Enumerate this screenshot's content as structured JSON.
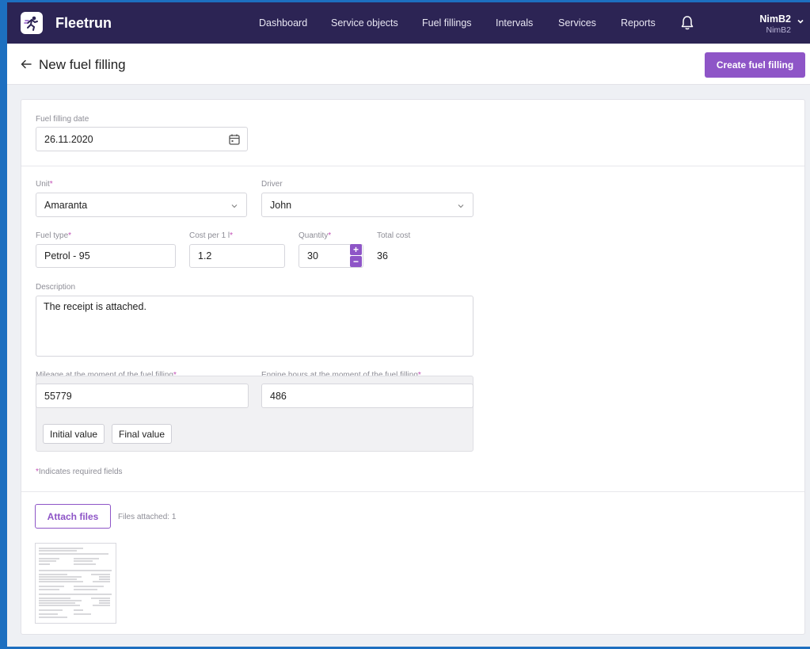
{
  "nav": {
    "app_name": "Fleetrun",
    "items": [
      {
        "label": "Dashboard"
      },
      {
        "label": "Service objects"
      },
      {
        "label": "Fuel fillings"
      },
      {
        "label": "Intervals"
      },
      {
        "label": "Services"
      },
      {
        "label": "Reports"
      }
    ],
    "user": {
      "name": "NimB2",
      "subtitle": "NimB2"
    }
  },
  "header": {
    "title": "New fuel filling",
    "create_label": "Create fuel filling"
  },
  "form": {
    "date": {
      "label": "Fuel filling date",
      "value": "26.11.2020"
    },
    "unit": {
      "label": "Unit",
      "value": "Amaranta"
    },
    "driver": {
      "label": "Driver",
      "value": "John"
    },
    "fuel_type": {
      "label": "Fuel type",
      "value": "Petrol - 95"
    },
    "cost_per_l": {
      "label": "Cost per 1 l",
      "value": "1.2"
    },
    "quantity": {
      "label": "Quantity",
      "value": "30"
    },
    "total_cost": {
      "label": "Total cost",
      "value": "36"
    },
    "description": {
      "label": "Description",
      "value": "The receipt is attached."
    },
    "mileage": {
      "label": "Mileage at the moment of the fuel filling",
      "value": "55779"
    },
    "engine_hours": {
      "label": "Engine hours at the moment of the fuel filling",
      "value": "486"
    },
    "initial_value_label": "Initial value",
    "final_value_label": "Final value",
    "required_note": "Indicates required fields",
    "required_mark": "*"
  },
  "attachments": {
    "button_label": "Attach files",
    "count_text": "Files attached: 1"
  },
  "colors": {
    "accent": "#8e55c7",
    "navbar": "#2c2454",
    "required": "#c24fb5"
  }
}
